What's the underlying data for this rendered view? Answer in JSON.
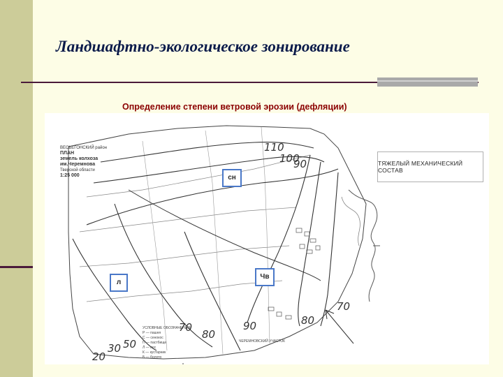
{
  "slide": {
    "title": "Ландшафтно-экологическое зонирование",
    "subtitle": "Определение степени ветровой эрозии (дефляции)"
  },
  "map": {
    "header": {
      "line1": "ВЕСЬЕГОНСКИЙ район",
      "line2": "ПЛАН",
      "line3": "земель колхоза им.Черемнова",
      "line4": "Тверской области",
      "scale": "1:25 000"
    },
    "zones": {
      "sn": "сн",
      "l": "л",
      "chv": "Чв"
    },
    "composition": "ТЯЖЕЛЫЙ МЕХАНИЧЕСКИЙ СОСТАВ",
    "contours": [
      "110",
      "100",
      "90",
      "70",
      "80",
      "90",
      "80",
      "70",
      "50",
      "30",
      "20"
    ],
    "legend": [
      "УСЛОВНЫЕ ОБОЗНАЧЕНИЯ",
      "Р — пашня",
      "С — сенокос",
      "П — пастбище",
      "Л — лес",
      "К — кустарник",
      "Б — болото"
    ],
    "caption": "ЧЕРЕМНОВСКИЙ УЧАСТОК"
  }
}
